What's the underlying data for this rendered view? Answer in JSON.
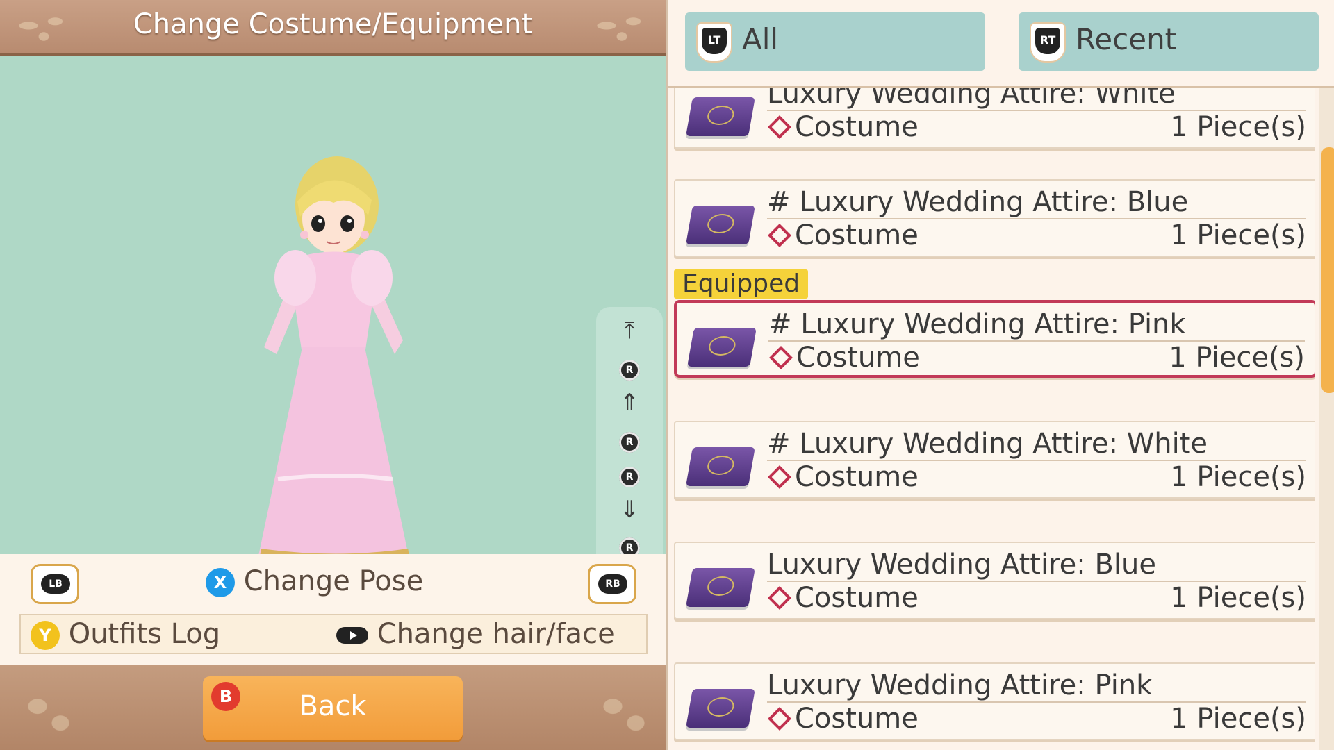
{
  "header": {
    "title": "Change Costume/Equipment"
  },
  "camera": {
    "r_label": "R",
    "icons": [
      "camera-top-icon",
      "rotate-up-icon",
      "zoom-in-icon",
      "rotate-left-icon",
      "rotate-right-icon",
      "zoom-out-icon",
      "rotate-down-icon",
      "camera-bottom-icon"
    ]
  },
  "controls": {
    "lb": "LB",
    "rb": "RB",
    "x_button": "X",
    "change_pose": "Change Pose",
    "y_button": "Y",
    "outfits_log": "Outfits Log",
    "change_hair_face": "Change hair/face"
  },
  "footer": {
    "b_button": "B",
    "back_label": "Back"
  },
  "tabs": [
    {
      "badge": "LT",
      "label": "All"
    },
    {
      "badge": "RT",
      "label": "Recent"
    }
  ],
  "equipped_tag": "Equipped",
  "items": [
    {
      "name": "Luxury Wedding Attire: White",
      "category": "Costume",
      "quantity": "1 Piece(s)"
    },
    {
      "name": "# Luxury Wedding Attire: Blue",
      "category": "Costume",
      "quantity": "1 Piece(s)"
    },
    {
      "name": "# Luxury Wedding Attire: Pink",
      "category": "Costume",
      "quantity": "1 Piece(s)"
    },
    {
      "name": "# Luxury Wedding Attire: White",
      "category": "Costume",
      "quantity": "1 Piece(s)"
    },
    {
      "name": "Luxury Wedding Attire: Blue",
      "category": "Costume",
      "quantity": "1 Piece(s)"
    },
    {
      "name": "Luxury Wedding Attire: Pink",
      "category": "Costume",
      "quantity": "1 Piece(s)"
    }
  ],
  "scroll": {
    "position_fraction": 0.1,
    "visible_fraction": 0.37
  },
  "colors": {
    "stage_bg": "#afd8c6",
    "tab_bg": "#a9d1cd",
    "selection": "#c23a58",
    "equipped": "#f5d23a",
    "back_button": "#f29c3a"
  }
}
